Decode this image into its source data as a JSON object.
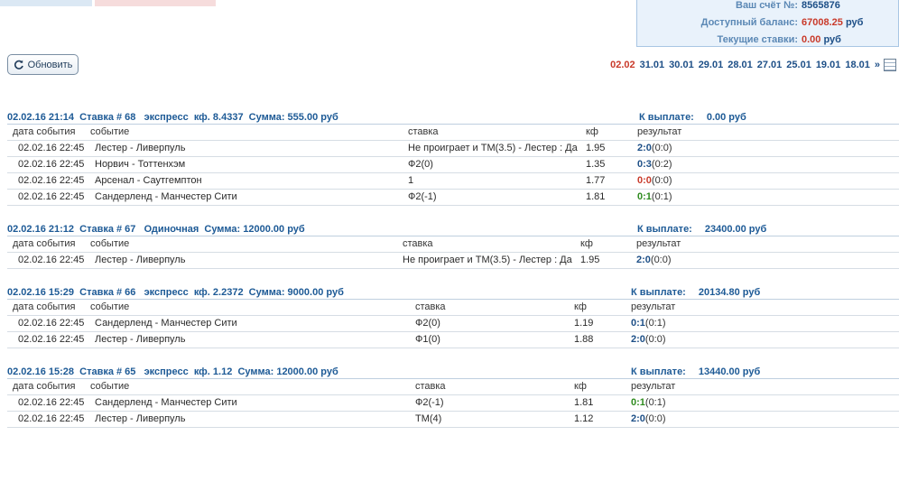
{
  "account": {
    "number_label": "Ваш счёт №:",
    "number": "8565876",
    "balance_label": "Доступный баланс:",
    "balance": "67008.25",
    "balance_unit": "руб",
    "current_label": "Текущие ставки:",
    "current": "0.00",
    "current_unit": "руб"
  },
  "toolbar": {
    "refresh_label": "Обновить",
    "refresh_icon": "refresh-icon"
  },
  "dates": {
    "current": "02.02",
    "items": [
      "31.01",
      "30.01",
      "29.01",
      "28.01",
      "27.01",
      "25.01",
      "19.01",
      "18.01"
    ],
    "more": "»",
    "calendar_icon": "calendar-icon"
  },
  "columns": {
    "date": "дата события",
    "event": "событие",
    "bet": "ставка",
    "kf": "кф",
    "result": "результат"
  },
  "colors": {
    "accent": "#1d5a96",
    "loss": "#c93a2a",
    "win": "#2e8b1e"
  },
  "bets": [
    {
      "title": "02.02.16 21:14  Ставка # 68   экспресс  кф. 8.4337  Сумма: 555.00 руб",
      "payout_label": "К выплате:",
      "payout_value": "0.00 руб",
      "rows": [
        {
          "date": "02.02.16 22:45",
          "event": "Лестер - Ливерпуль",
          "bet": "Не проиграет и ТМ(3.5) - Лестер : Да",
          "kf": "1.95",
          "score": "2:0",
          "rest": " (0:0)",
          "score_color": "blue"
        },
        {
          "date": "02.02.16 22:45",
          "event": "Норвич - Тоттенхэм",
          "bet": "Ф2(0)",
          "kf": "1.35",
          "score": "0:3",
          "rest": " (0:2)",
          "score_color": "blue"
        },
        {
          "date": "02.02.16 22:45",
          "event": "Арсенал - Саутгемптон",
          "bet": "1",
          "kf": "1.77",
          "score": "0:0",
          "rest": " (0:0)",
          "score_color": "red"
        },
        {
          "date": "02.02.16 22:45",
          "event": "Сандерленд - Манчестер Сити",
          "bet": "Ф2(-1)",
          "kf": "1.81",
          "score": "0:1",
          "rest": " (0:1)",
          "score_color": "green"
        }
      ]
    },
    {
      "title": "02.02.16 21:12  Ставка # 67   Одиночная  Сумма: 12000.00 руб",
      "payout_label": "К выплате:",
      "payout_value": "23400.00 руб",
      "rows": [
        {
          "date": "02.02.16 22:45",
          "event": "Лестер - Ливерпуль",
          "bet": "Не проиграет и ТМ(3.5) - Лестер : Да",
          "kf": "1.95",
          "score": "2:0",
          "rest": " (0:0)",
          "score_color": "blue"
        }
      ]
    },
    {
      "title": "02.02.16 15:29  Ставка # 66   экспресс  кф. 2.2372  Сумма: 9000.00 руб",
      "payout_label": "К выплате:",
      "payout_value": "20134.80 руб",
      "rows": [
        {
          "date": "02.02.16 22:45",
          "event": "Сандерленд - Манчестер Сити",
          "bet": "Ф2(0)",
          "kf": "1.19",
          "score": "0:1",
          "rest": " (0:1)",
          "score_color": "blue"
        },
        {
          "date": "02.02.16 22:45",
          "event": "Лестер - Ливерпуль",
          "bet": "Ф1(0)",
          "kf": "1.88",
          "score": "2:0",
          "rest": " (0:0)",
          "score_color": "blue"
        }
      ]
    },
    {
      "title": "02.02.16 15:28  Ставка # 65   экспресс  кф. 1.12  Сумма: 12000.00 руб",
      "payout_label": "К выплате:",
      "payout_value": "13440.00 руб",
      "rows": [
        {
          "date": "02.02.16 22:45",
          "event": "Сандерленд - Манчестер Сити",
          "bet": "Ф2(-1)",
          "kf": "1.81",
          "score": "0:1",
          "rest": " (0:1)",
          "score_color": "green"
        },
        {
          "date": "02.02.16 22:45",
          "event": "Лестер - Ливерпуль",
          "bet": "ТМ(4)",
          "kf": "1.12",
          "score": "2:0",
          "rest": " (0:0)",
          "score_color": "blue"
        }
      ]
    }
  ]
}
